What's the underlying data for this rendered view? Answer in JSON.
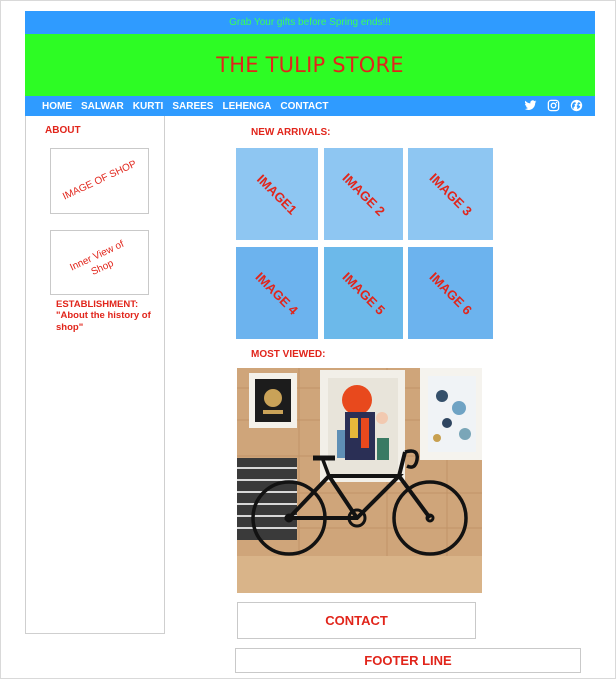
{
  "announcement": "Grab Your gifts before Spring ends!!!",
  "store_title": "THE TULIP STORE",
  "nav": {
    "items": [
      "HOME",
      "SALWAR",
      "KURTI",
      "SAREES",
      "LEHENGA",
      "CONTACT"
    ],
    "social_icons": [
      "twitter-icon",
      "instagram-icon",
      "globe-icon"
    ]
  },
  "sidebar": {
    "about_label": "ABOUT",
    "shop_image_label": "IMAGE OF SHOP",
    "inner_view_label": "Inner View of Shop",
    "establishment": "ESTABLISHMENT: \"About the history of shop\""
  },
  "new_arrivals": {
    "title": "NEW ARRIVALS:",
    "images": [
      "IMAGE1",
      "IMAGE 2",
      "IMAGE 3",
      "IMAGE 4",
      "IMAGE 5",
      "IMAGE 6"
    ]
  },
  "most_viewed": {
    "title": "MOST VIEWED:"
  },
  "contact_label": "CONTACT",
  "footer_label": "FOOTER LINE",
  "colors": {
    "nav_blue": "#2f9bff",
    "hero_green": "#2dfc24",
    "accent_red": "#e1251b",
    "tile_colors": [
      "#8ec6f2",
      "#8ec6f2",
      "#8ec6f2",
      "#6cb3ee",
      "#6cb9ea",
      "#6cb3ee"
    ]
  }
}
